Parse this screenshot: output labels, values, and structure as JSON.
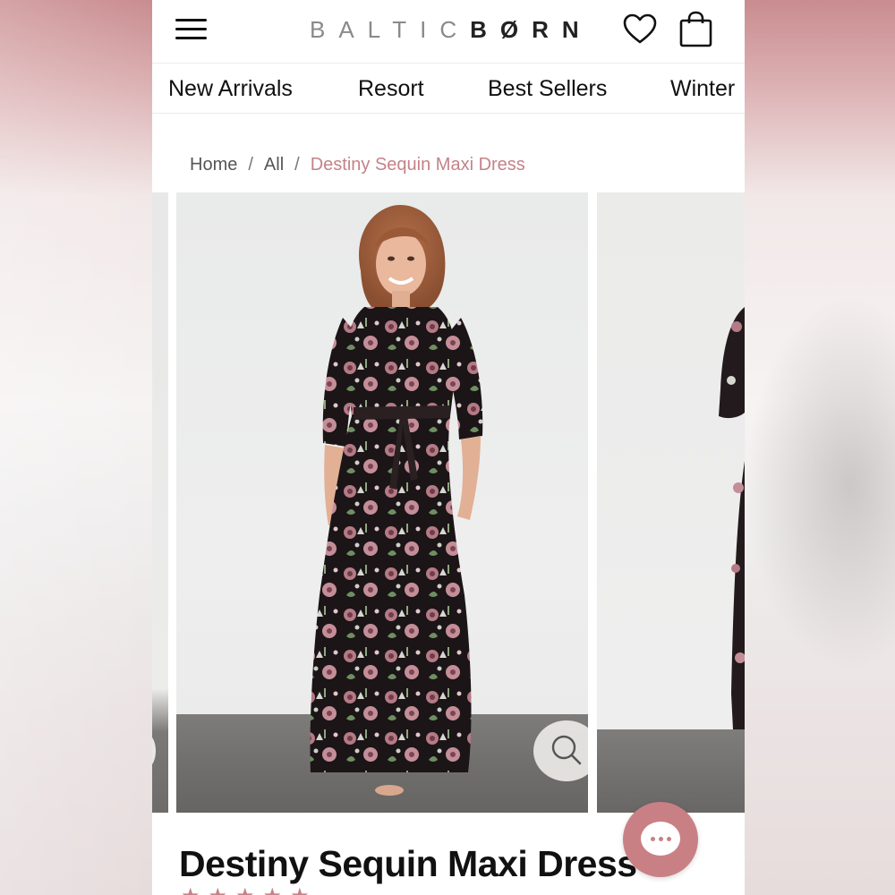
{
  "header": {
    "logo_part1": "BALTIC",
    "logo_part2": "BØRN",
    "icons": [
      "hamburger-menu-icon",
      "heart-icon",
      "shopping-bag-icon"
    ]
  },
  "nav": {
    "items": [
      "New Arrivals",
      "Resort",
      "Best Sellers",
      "Winter"
    ]
  },
  "breadcrumb": {
    "home": "Home",
    "separator": "/",
    "all": "All",
    "current": "Destiny Sequin Maxi Dress"
  },
  "product": {
    "title": "Destiny Sequin Maxi Dress",
    "rating_stars": 5
  },
  "colors": {
    "accent": "#c48288",
    "chat_button": "#c98085",
    "dress_base": "#1a1416"
  }
}
